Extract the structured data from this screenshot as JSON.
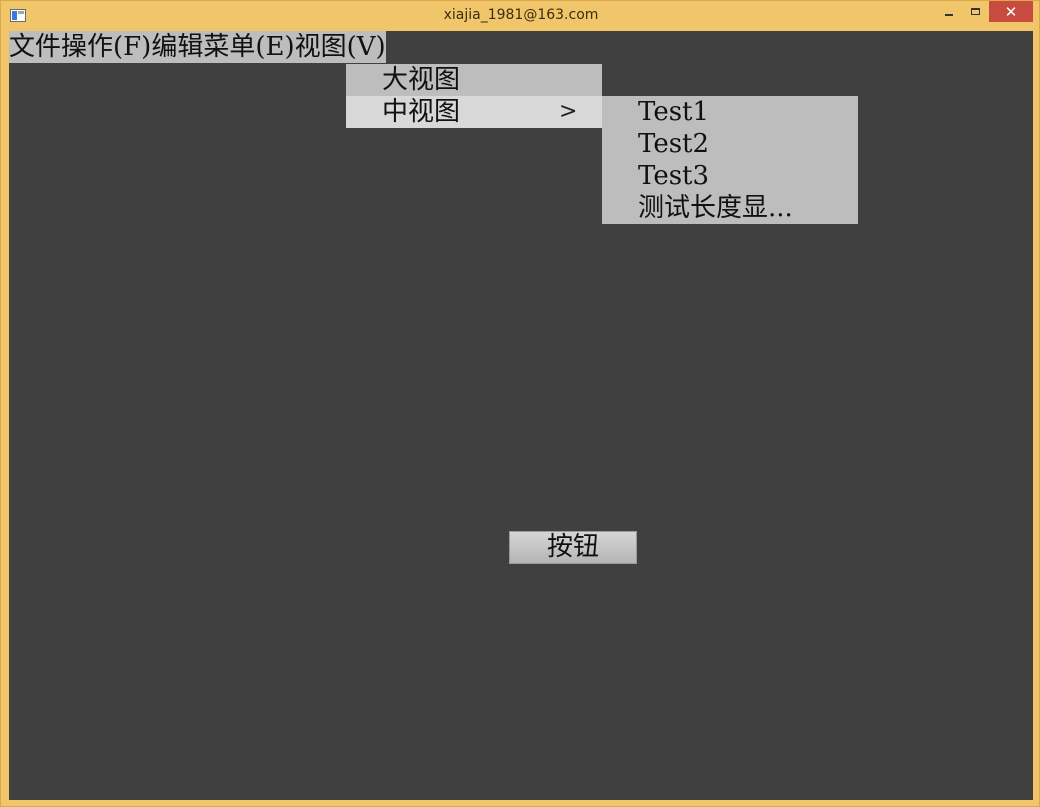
{
  "window": {
    "title": "xiajia_1981@163.com",
    "controls": {
      "minimize": "",
      "maximize": "",
      "close": "✕"
    }
  },
  "menubar": {
    "items": [
      {
        "label": "文件操作(F)"
      },
      {
        "label": "编辑菜单(E)"
      },
      {
        "label": "视图(V)"
      }
    ]
  },
  "view_menu": {
    "items": [
      {
        "label": "大视图"
      },
      {
        "label": "中视图",
        "has_submenu": true
      }
    ],
    "submenu_arrow": ">"
  },
  "submenu": {
    "items": [
      {
        "label": "Test1"
      },
      {
        "label": "Test2"
      },
      {
        "label": "Test3"
      },
      {
        "label": "测试长度显..."
      }
    ]
  },
  "main": {
    "button_label": "按钮"
  },
  "colors": {
    "frame": "#f1c56a",
    "client_bg": "#404040",
    "menu_bg": "#bdbdbd",
    "menu_highlight": "#d8d8d8",
    "close_button": "#c74b3e"
  }
}
